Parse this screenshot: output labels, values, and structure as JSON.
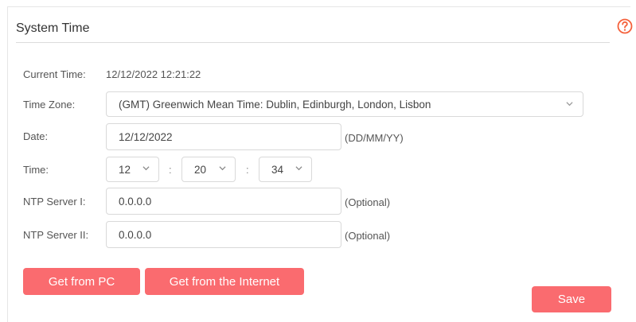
{
  "section": {
    "title": "System Time",
    "help_icon": "question-circle-icon"
  },
  "colors": {
    "accent": "#fa6b6f",
    "help": "#f5603a"
  },
  "rows": {
    "current_time": {
      "label": "Current Time:",
      "value": "12/12/2022 12:21:22"
    },
    "time_zone": {
      "label": "Time Zone:",
      "value": "(GMT) Greenwich Mean Time: Dublin, Edinburgh, London, Lisbon"
    },
    "date": {
      "label": "Date:",
      "value": "12/12/2022",
      "hint": "(DD/MM/YY)"
    },
    "time": {
      "label": "Time:",
      "hour": "12",
      "minute": "20",
      "second": "34",
      "separator": ":"
    },
    "ntp1": {
      "label": "NTP Server I:",
      "value": "0.0.0.0",
      "hint": "(Optional)"
    },
    "ntp2": {
      "label": "NTP Server II:",
      "value": "0.0.0.0",
      "hint": "(Optional)"
    }
  },
  "buttons": {
    "get_from_pc": "Get from PC",
    "get_from_internet": "Get from the Internet",
    "save": "Save"
  }
}
